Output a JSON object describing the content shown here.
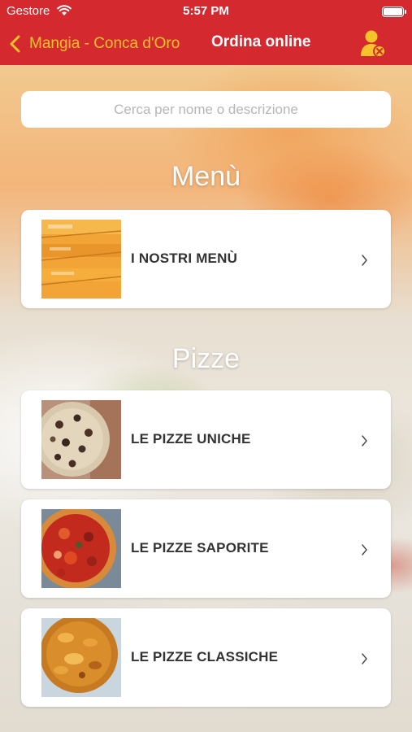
{
  "status_bar": {
    "carrier": "Gestore",
    "time": "5:57 PM"
  },
  "nav": {
    "back_label": "Mangia - Conca d'Oro",
    "title": "Ordina online",
    "accent_color": "#f6c32a",
    "bar_color": "#d42a2f"
  },
  "search": {
    "placeholder": "Cerca per nome o descrizione",
    "value": ""
  },
  "sections": [
    {
      "title": "Menù",
      "items": [
        {
          "label": "I NOSTRI MENÙ",
          "icon": "pizza-boxes-photo"
        }
      ]
    },
    {
      "title": "Pizze",
      "items": [
        {
          "label": "LE PIZZE UNICHE",
          "icon": "pizza-photo"
        },
        {
          "label": "LE PIZZE SAPORITE",
          "icon": "pizza-photo"
        },
        {
          "label": "LE PIZZE CLASSICHE",
          "icon": "pizza-photo"
        }
      ]
    }
  ]
}
